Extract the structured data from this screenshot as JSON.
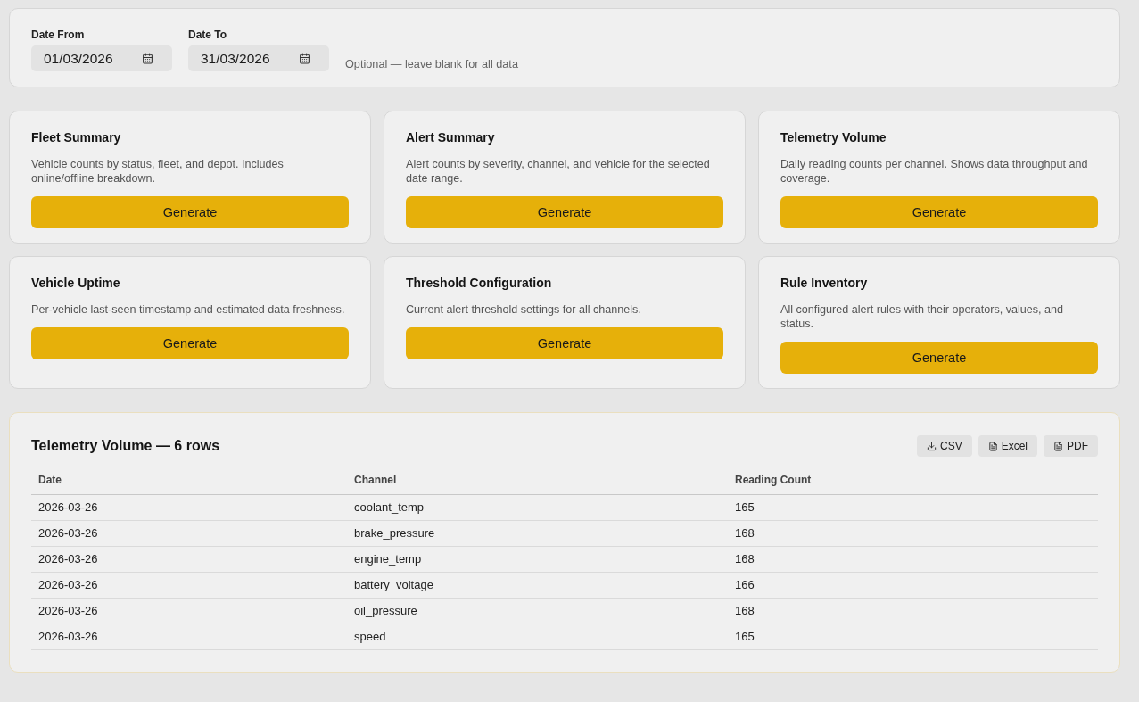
{
  "filters": {
    "fields": [
      {
        "label": "Date From",
        "value": "01/03/2026"
      },
      {
        "label": "Date To",
        "value": "31/03/2026"
      }
    ],
    "hint": "Optional — leave blank for all data"
  },
  "reports": [
    {
      "title": "Fleet Summary",
      "description": "Vehicle counts by status, fleet, and depot. Includes online/offline breakdown.",
      "button": "Generate"
    },
    {
      "title": "Alert Summary",
      "description": "Alert counts by severity, channel, and vehicle for the selected date range.",
      "button": "Generate"
    },
    {
      "title": "Telemetry Volume",
      "description": "Daily reading counts per channel. Shows data throughput and coverage.",
      "button": "Generate"
    },
    {
      "title": "Vehicle Uptime",
      "description": "Per-vehicle last-seen timestamp and estimated data freshness.",
      "button": "Generate"
    },
    {
      "title": "Threshold Configuration",
      "description": "Current alert threshold settings for all channels.",
      "button": "Generate"
    },
    {
      "title": "Rule Inventory",
      "description": "All configured alert rules with their operators, values, and status.",
      "button": "Generate"
    }
  ],
  "results": {
    "title": "Telemetry Volume — 6 rows",
    "exports": [
      {
        "kind": "download",
        "label": "CSV"
      },
      {
        "kind": "file",
        "label": "Excel"
      },
      {
        "kind": "file",
        "label": "PDF"
      }
    ],
    "table": {
      "columns": [
        "Date",
        "Channel",
        "Reading Count"
      ],
      "rows": [
        [
          "2026-03-26",
          "coolant_temp",
          "165"
        ],
        [
          "2026-03-26",
          "brake_pressure",
          "168"
        ],
        [
          "2026-03-26",
          "engine_temp",
          "168"
        ],
        [
          "2026-03-26",
          "battery_voltage",
          "166"
        ],
        [
          "2026-03-26",
          "oil_pressure",
          "168"
        ],
        [
          "2026-03-26",
          "speed",
          "165"
        ]
      ]
    }
  }
}
